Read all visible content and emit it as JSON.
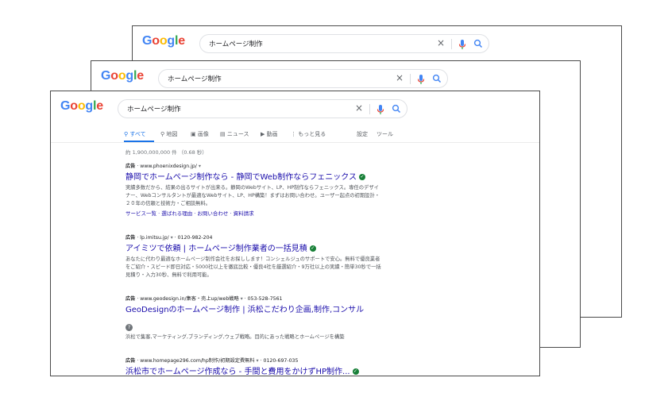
{
  "logo": {
    "l1": "G",
    "l2": "o",
    "l3": "o",
    "l4": "g",
    "l5": "l",
    "l6": "e"
  },
  "search": {
    "query": "ホームページ制作",
    "clear_glyph": "×"
  },
  "icons": {
    "clear": "close-icon",
    "mic": "mic-icon",
    "search": "search-icon"
  },
  "tabs": {
    "all": "すべて",
    "maps": "地図",
    "images": "画像",
    "news": "ニュース",
    "videos": "動画",
    "more": "もっと見る",
    "settings": "設定",
    "tools": "ツール"
  },
  "stats": "約 1,900,000,000 件 （0.68 秒）",
  "ads": [
    {
      "label": "広告",
      "url": "www.phoenixdesign.jp/",
      "phone": "",
      "title": "静岡でホームページ制作なら - 静岡でWeb制作ならフェニックス",
      "desc": "実績多数だから、結果の出るサイトが出来る。静岡のWebサイト、LP、HP制作ならフェニックス。専任のデザイナー、Webコンサルタントが最適なWebサイト、LP、HP構築！まずはお問い合わせ。ユーザー起点の初期設計・２０年の信頼と技術力・ご相談無料。",
      "sitelinks": "サービス一覧 · 選ばれる理由 · お問い合わせ · 資料請求"
    },
    {
      "label": "広告",
      "url": "lp.imitsu.jp/",
      "phone": "0120-982-204",
      "title": "アイミツで依頼 | ホームページ制作業者の一括見積",
      "desc": "あなたに代わり最適なホームページ制作会社をお探しします！コンシェルジュのサポートで安心。無料で優良業者をご紹介・スピード即日対応・5000社以上を徹底比較・優良4社を厳選紹介・9万社以上の実績・簡単30秒で一括見積り・入力30秒、無料で利用可能。",
      "sitelinks": ""
    },
    {
      "label": "広告",
      "url": "www.geodesign.in/集客・売上up/web戦略",
      "phone": "053-528-7561",
      "title": "GeoDesignのホームページ制作 | 浜松こだわり企画,制作,コンサル",
      "qmark": "?",
      "desc": "浜松で集客,マーケティング,ブランディング,ウェブ戦略。目的にあった戦略とホームページを構築",
      "sitelinks": ""
    },
    {
      "label": "広告",
      "url": "www.homepage296.com/hp制作/初期設定費無料",
      "phone": "0120-697-035",
      "title": "浜松市でホームページ作成なら - 手間と費用をかけずHP制作...",
      "desc": "",
      "sitelinks": ""
    }
  ]
}
